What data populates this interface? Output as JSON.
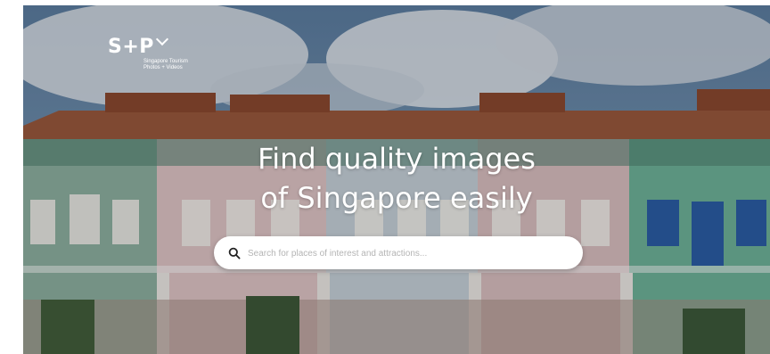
{
  "brand": {
    "logo_mark": "S+P",
    "tagline_line1": "Singapore Tourism",
    "tagline_line2": "Photos + Videos"
  },
  "hero": {
    "headline_line1": "Find quality images",
    "headline_line2": "of Singapore easily"
  },
  "search": {
    "placeholder": "Search for places of interest and attractions..."
  },
  "icons": [
    "chevron-down-icon",
    "search-icon"
  ],
  "colors": {
    "text_on_hero": "#ffffff",
    "search_bg": "#ffffff",
    "placeholder": "#b4b4b4"
  }
}
